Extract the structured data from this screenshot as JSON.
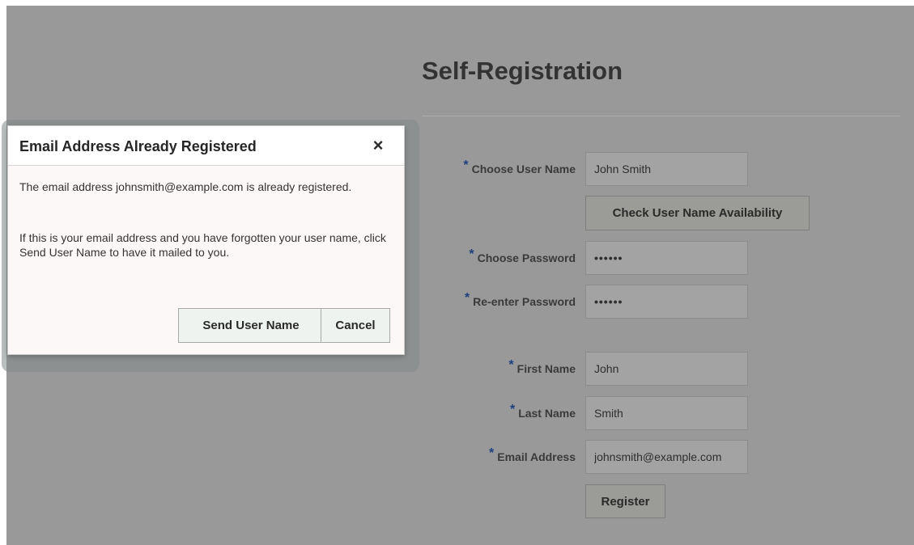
{
  "page": {
    "title": "Self-Registration"
  },
  "form": {
    "required_marker": "*",
    "username": {
      "label": "Choose User Name",
      "value": "John Smith"
    },
    "check_button": "Check User Name Availability",
    "password": {
      "label": "Choose Password",
      "value": "••••••"
    },
    "reenter_password": {
      "label": "Re-enter Password",
      "value": "••••••"
    },
    "first_name": {
      "label": "First Name",
      "value": "John"
    },
    "last_name": {
      "label": "Last Name",
      "value": "Smith"
    },
    "email": {
      "label": "Email Address",
      "value": "johnsmith@example.com"
    },
    "register_button": "Register"
  },
  "dialog": {
    "title": "Email Address Already Registered",
    "close_glyph": "×",
    "message1": "The email address johnsmith@example.com is already registered.",
    "message2": "If this is your email address and you have forgotten your user name, click Send User Name to have it mailed to you.",
    "send_button": "Send User Name",
    "cancel_button": "Cancel"
  },
  "colors": {
    "modal_overlay": "#999999",
    "dialog_background": "#fdf8f8",
    "required_star": "#1f3f7f",
    "dialog_button": "#eff3ef"
  },
  "icons": {
    "close": "close-icon"
  }
}
